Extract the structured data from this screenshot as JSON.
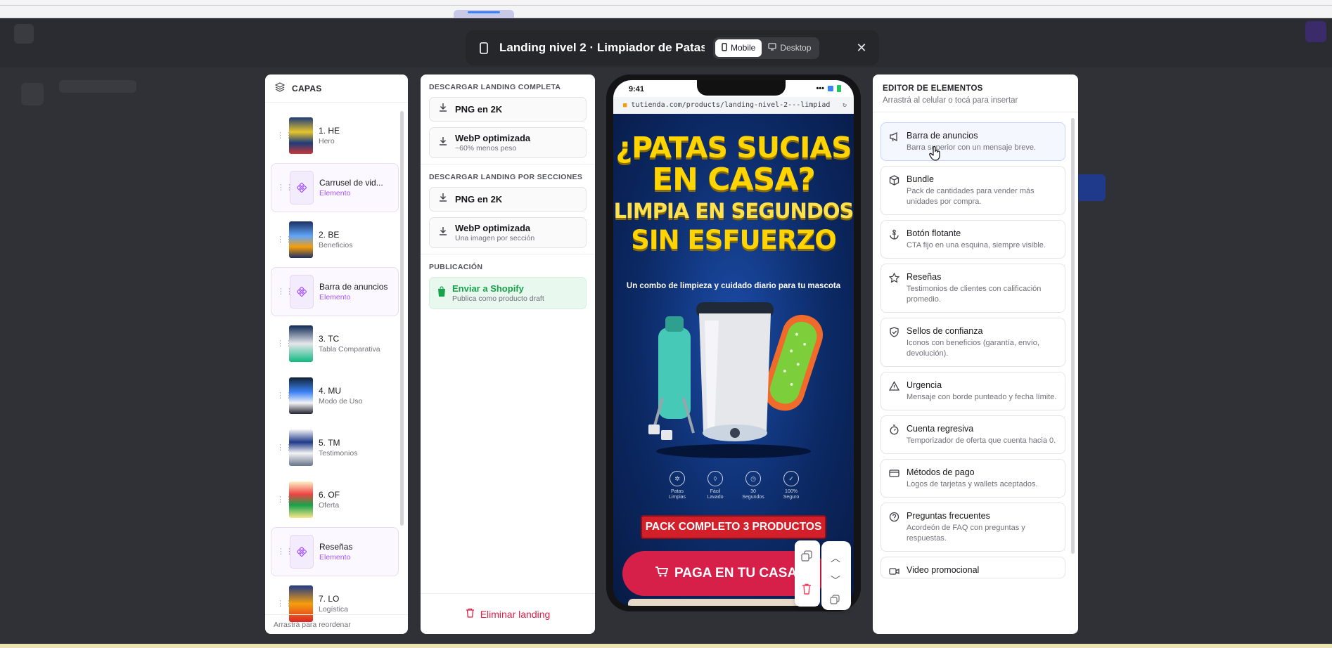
{
  "modal": {
    "title": "Landing nivel 2 · Limpiador de Patas ...",
    "view_mobile": "Mobile",
    "view_desktop": "Desktop",
    "close": "✕"
  },
  "layers": {
    "header": "CAPAS",
    "items": [
      {
        "name": "1. HE",
        "sub": "Hero",
        "kind": "section"
      },
      {
        "name": "Carrusel de vid...",
        "sub": "Elemento",
        "kind": "element"
      },
      {
        "name": "2. BE",
        "sub": "Beneficios",
        "kind": "section"
      },
      {
        "name": "Barra de anuncios",
        "sub": "Elemento",
        "kind": "element"
      },
      {
        "name": "3. TC",
        "sub": "Tabla Comparativa",
        "kind": "section"
      },
      {
        "name": "4. MU",
        "sub": "Modo de Uso",
        "kind": "section"
      },
      {
        "name": "5. TM",
        "sub": "Testimonios",
        "kind": "section"
      },
      {
        "name": "6. OF",
        "sub": "Oferta",
        "kind": "section"
      },
      {
        "name": "Reseñas",
        "sub": "Elemento",
        "kind": "element"
      },
      {
        "name": "7. LO",
        "sub": "Logística",
        "kind": "section"
      }
    ],
    "footer": "Arrastrá para reordenar"
  },
  "downloads": {
    "full_header": "DESCARGAR LANDING COMPLETA",
    "full_png": "PNG en 2K",
    "full_webp": "WebP optimizada",
    "full_webp_sub": "~60% menos peso",
    "sections_header": "DESCARGAR LANDING POR SECCIONES",
    "sec_png": "PNG en 2K",
    "sec_webp": "WebP optimizada",
    "sec_webp_sub": "Una imagen por sección",
    "publish_header": "PUBLICACIÓN",
    "shopify": "Enviar a Shopify",
    "shopify_sub": "Publica como producto draft",
    "delete": "Eliminar landing"
  },
  "phone": {
    "time": "9:41",
    "url": "tutienda.com/products/landing-nivel-2---limpiad",
    "headline1": "¿PATAS SUCIAS",
    "headline2": "EN CASA?",
    "headline3": "LIMPIA EN SEGUNDOS",
    "headline4": "SIN ESFUERZO",
    "subheadline": "Un combo de limpieza y cuidado diario para tu mascota",
    "features": [
      {
        "line1": "Patas",
        "line2": "Limpias"
      },
      {
        "line1": "Fácil",
        "line2": "Lavado"
      },
      {
        "line1": "30",
        "line2": "Segundos"
      },
      {
        "line1": "100%",
        "line2": "Seguro"
      }
    ],
    "pack": "PACK COMPLETO 3 PRODUCTOS",
    "cta": "PAGA EN TU CASA"
  },
  "editor": {
    "header": "EDITOR DE ELEMENTOS",
    "subheader": "Arrastrá al celular o tocá para insertar",
    "items": [
      {
        "title": "Barra de anuncios",
        "desc": "Barra superior con un mensaje breve.",
        "icon": "megaphone-icon"
      },
      {
        "title": "Bundle",
        "desc": "Pack de cantidades para vender más unidades por compra.",
        "icon": "box-icon"
      },
      {
        "title": "Botón flotante",
        "desc": "CTA fijo en una esquina, siempre visible.",
        "icon": "anchor-icon"
      },
      {
        "title": "Reseñas",
        "desc": "Testimonios de clientes con calificación promedio.",
        "icon": "star-icon"
      },
      {
        "title": "Sellos de confianza",
        "desc": "Iconos con beneficios (garantía, envío, devolución).",
        "icon": "shield-icon"
      },
      {
        "title": "Urgencia",
        "desc": "Mensaje con borde punteado y fecha límite.",
        "icon": "warning-icon"
      },
      {
        "title": "Cuenta regresiva",
        "desc": "Temporizador de oferta que cuenta hacia 0.",
        "icon": "timer-icon"
      },
      {
        "title": "Métodos de pago",
        "desc": "Logos de tarjetas y wallets aceptados.",
        "icon": "card-icon"
      },
      {
        "title": "Preguntas frecuentes",
        "desc": "Acordeón de FAQ con preguntas y respuestas.",
        "icon": "help-icon"
      },
      {
        "title": "Video promocional",
        "desc": "",
        "icon": "video-icon"
      }
    ]
  }
}
